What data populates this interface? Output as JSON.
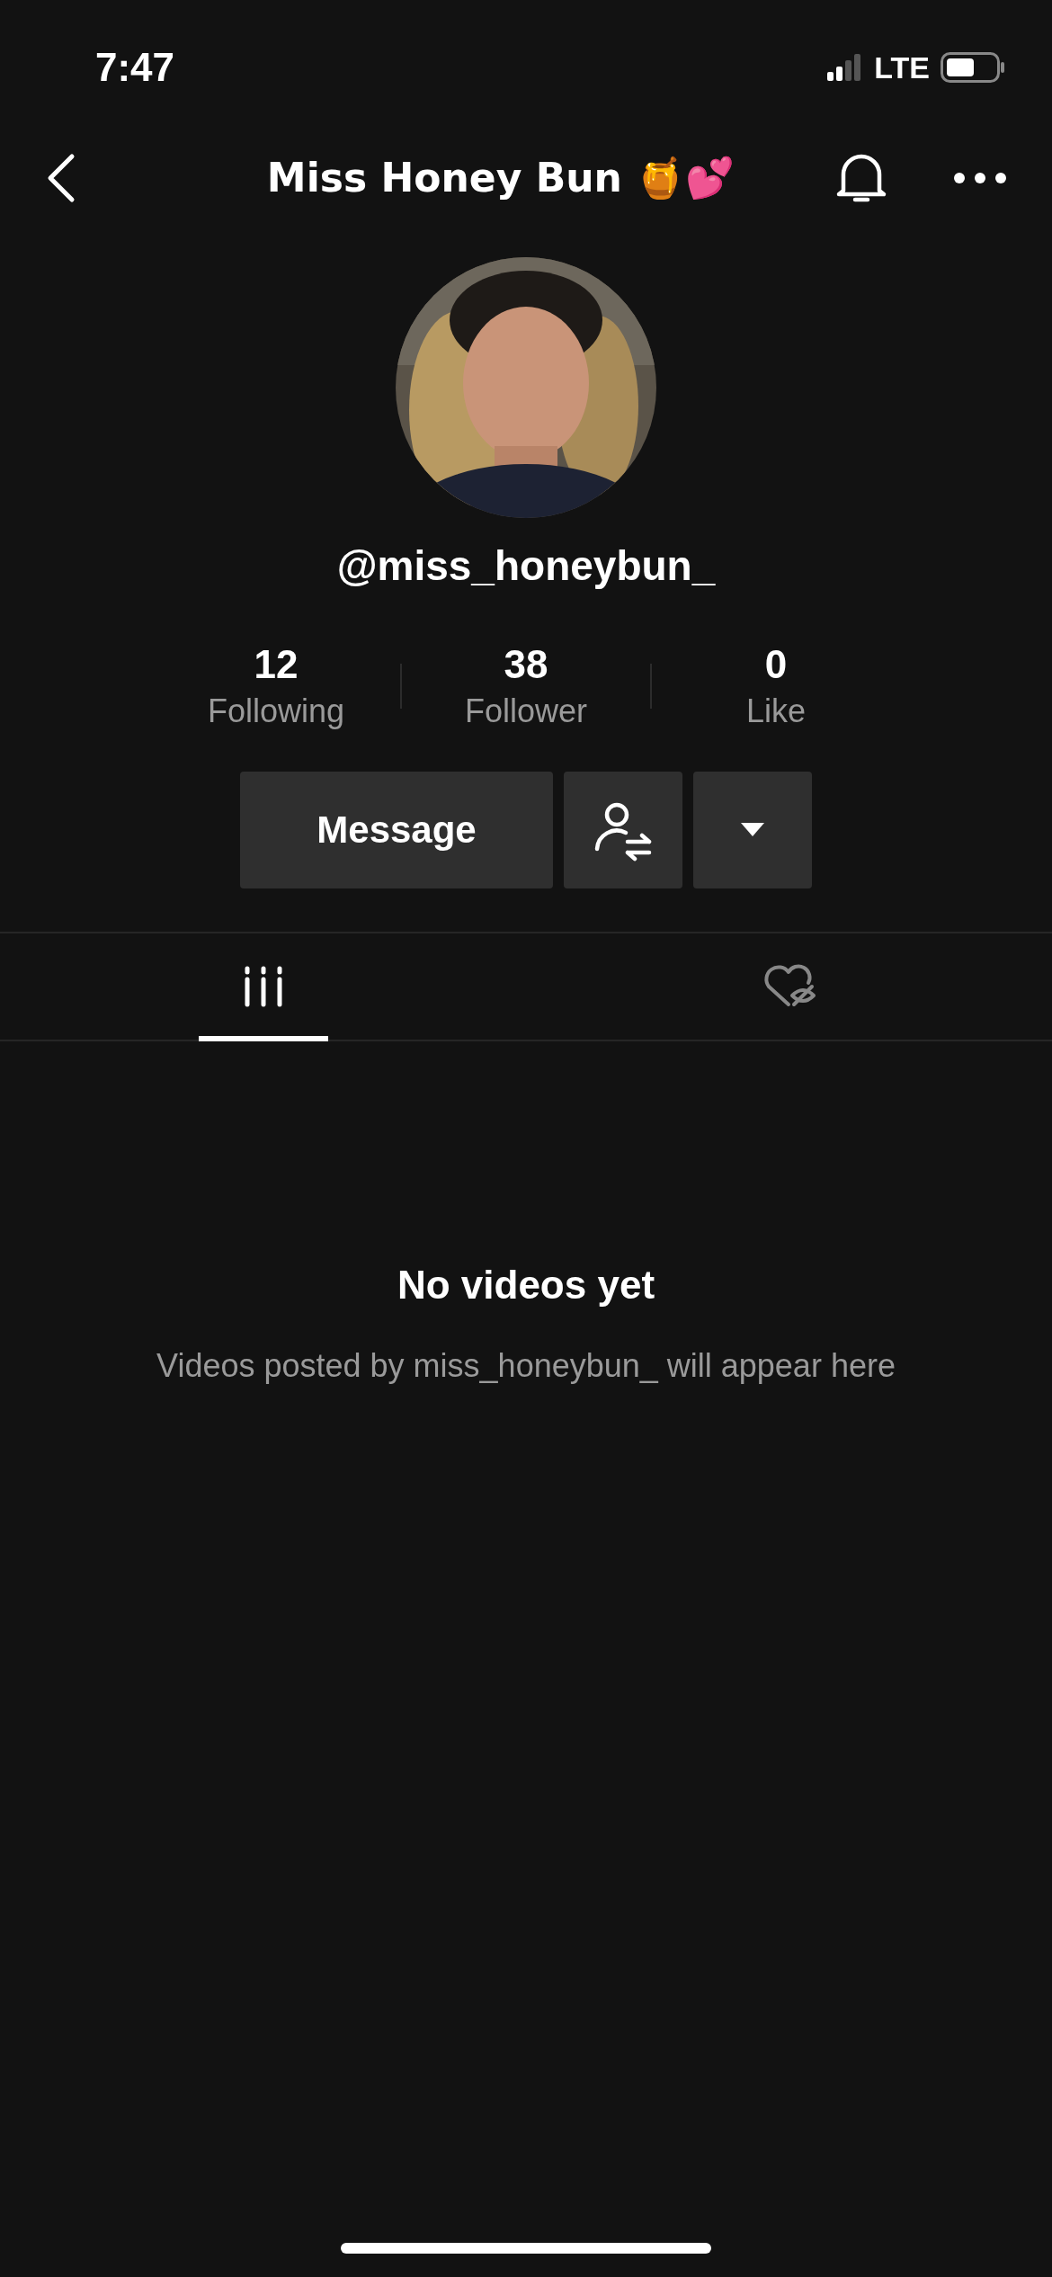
{
  "status_bar": {
    "time": "7:47",
    "network": "LTE"
  },
  "nav": {
    "title": "Miss Honey Bun 🍯💕"
  },
  "profile": {
    "username": "@miss_honeybun_"
  },
  "stats": [
    {
      "value": "12",
      "label": "Following"
    },
    {
      "value": "38",
      "label": "Follower"
    },
    {
      "value": "0",
      "label": "Like"
    }
  ],
  "actions": {
    "message": "Message"
  },
  "tabs": [
    {
      "kind": "videos",
      "selected": true
    },
    {
      "kind": "liked",
      "selected": false
    }
  ],
  "empty_state": {
    "title": "No videos yet",
    "subtitle": "Videos posted by miss_honeybun_ will appear here"
  }
}
